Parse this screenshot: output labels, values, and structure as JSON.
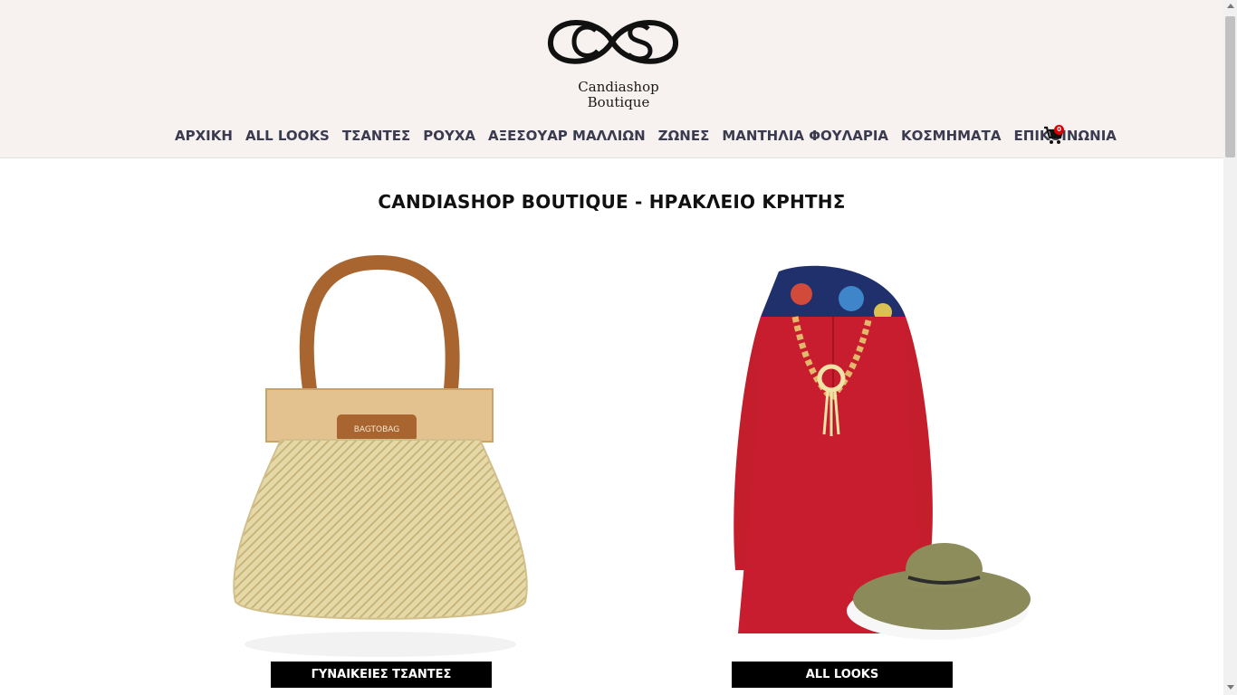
{
  "brand": {
    "line1": "Candiashop",
    "line2": "Boutique"
  },
  "nav": {
    "items": [
      {
        "label": "ΑΡΧΙΚΗ"
      },
      {
        "label": "ALL LOOKS"
      },
      {
        "label": "ΤΣΑΝΤΕΣ"
      },
      {
        "label": "ΡΟΥΧΑ"
      },
      {
        "label": "ΑΞΕΣΟΥΑΡ ΜΑΛΛΙΩΝ"
      },
      {
        "label": "ΖΩΝΕΣ"
      },
      {
        "label": "ΜΑΝΤΗΛΙΑ ΦΟΥΛΑΡΙΑ"
      },
      {
        "label": "ΚΟΣΜΗΜΑΤΑ"
      },
      {
        "label": "ΕΠΙΚΟΙΝΩΝΙΑ"
      }
    ],
    "cart_count": "0",
    "cart_icon": "cart-icon"
  },
  "page": {
    "title": "CANDIASHOP BOUTIQUE - ΗΡΑΚΛΕΙΟ ΚΡΗΤΗΣ"
  },
  "cards": [
    {
      "button": "ΓΥΝΑΙΚΕΙΕΣ ΤΣΑΝΤΕΣ",
      "bag_label": "BAGTOBAG"
    },
    {
      "button": "ALL LOOKS"
    }
  ],
  "colors": {
    "header_bg": "#f7f1f0",
    "nav_text": "#3b3b4f",
    "button_bg": "#000000",
    "badge": "#dd0000"
  }
}
